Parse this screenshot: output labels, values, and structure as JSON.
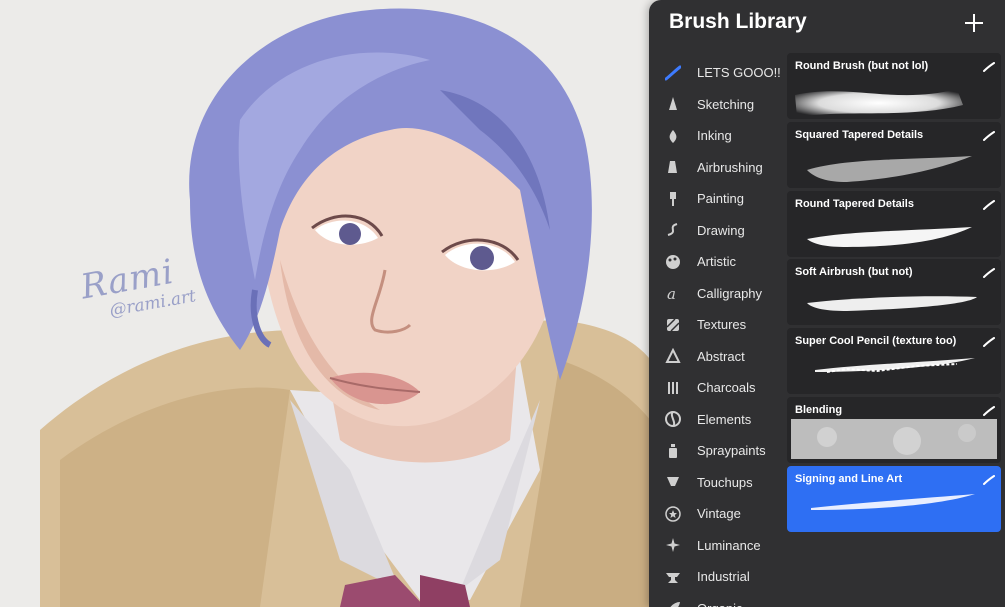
{
  "artwork": {
    "signature_name": "Rami",
    "signature_handle": "@rami.art"
  },
  "panel": {
    "title": "Brush Library",
    "add_icon": "plus-icon"
  },
  "categories": [
    {
      "label": "LETS GOOO!!",
      "icon": "brush-stroke-icon",
      "active": true
    },
    {
      "label": "Sketching",
      "icon": "pencil-tip-icon"
    },
    {
      "label": "Inking",
      "icon": "ink-drop-icon"
    },
    {
      "label": "Airbrushing",
      "icon": "airbrush-icon"
    },
    {
      "label": "Painting",
      "icon": "paintbrush-icon"
    },
    {
      "label": "Drawing",
      "icon": "squiggle-icon"
    },
    {
      "label": "Artistic",
      "icon": "palette-icon"
    },
    {
      "label": "Calligraphy",
      "icon": "calligraphy-icon"
    },
    {
      "label": "Textures",
      "icon": "texture-icon"
    },
    {
      "label": "Abstract",
      "icon": "triangle-icon"
    },
    {
      "label": "Charcoals",
      "icon": "charcoal-icon"
    },
    {
      "label": "Elements",
      "icon": "yin-yang-icon"
    },
    {
      "label": "Spraypaints",
      "icon": "spray-can-icon"
    },
    {
      "label": "Touchups",
      "icon": "touchup-icon"
    },
    {
      "label": "Vintage",
      "icon": "star-badge-icon"
    },
    {
      "label": "Luminance",
      "icon": "sparkle-icon"
    },
    {
      "label": "Industrial",
      "icon": "anvil-icon"
    },
    {
      "label": "Organic",
      "icon": "leaf-icon"
    }
  ],
  "brushes": [
    {
      "name": "Round Brush (but not lol)",
      "stroke": "round",
      "selected": false
    },
    {
      "name": "Squared Tapered Details",
      "stroke": "squared",
      "selected": false
    },
    {
      "name": "Round Tapered Details",
      "stroke": "tapered",
      "selected": false
    },
    {
      "name": "Soft Airbrush (but not)",
      "stroke": "soft",
      "selected": false
    },
    {
      "name": "Super Cool Pencil (texture too)",
      "stroke": "pencil",
      "selected": false
    },
    {
      "name": "Blending",
      "stroke": "blend",
      "selected": false
    },
    {
      "name": "Signing and Line Art",
      "stroke": "line",
      "selected": true
    }
  ],
  "colors": {
    "panel_bg": "#303032",
    "card_bg": "#262628",
    "selected": "#2e6ff3",
    "accent_icon": "#3d7bff",
    "hair": "#8a8fd0",
    "jacket": "#d9c09a"
  }
}
